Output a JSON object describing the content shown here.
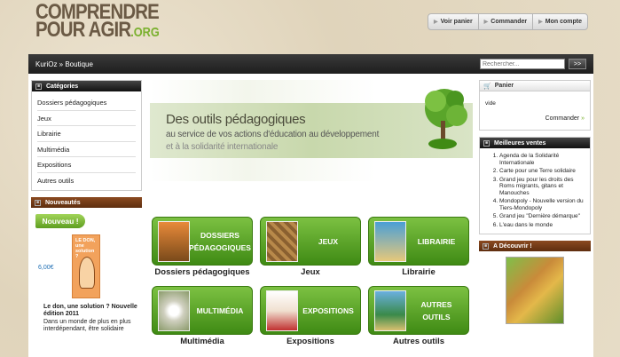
{
  "logo": {
    "line1": "COMPRENDRE",
    "line2": "POUR AGIR",
    "org": ".ORG"
  },
  "topnav": [
    {
      "label": "Voir panier"
    },
    {
      "label": "Commander"
    },
    {
      "label": "Mon compte"
    }
  ],
  "breadcrumb": "KuriOz » Boutique",
  "search": {
    "placeholder": "Rechercher...",
    "button": ">>"
  },
  "categories": {
    "title": "Catégories",
    "items": [
      "Dossiers pédagogiques",
      "Jeux",
      "Librairie",
      "Multimédia",
      "Expositions",
      "Autres outils"
    ]
  },
  "nouveautes": {
    "title": "Nouveautés",
    "ribbon": "Nouveau !",
    "price": "6,00€",
    "book_title": "LE DON, une solution ?",
    "item_title": "Le don, une solution ? Nouvelle édition 2011",
    "item_desc": "Dans un monde de plus en plus interdépendant, être solidaire"
  },
  "banner": {
    "line1": "Des outils pédagogiques",
    "line2": "au service de vos actions d'éducation au développement",
    "line3": "et à la solidarité internationale"
  },
  "tiles": [
    {
      "label1": "DOSSIERS",
      "label2": "PÉDAGOGIQUES",
      "caption": "Dossiers pédagogiques"
    },
    {
      "label1": "JEUX",
      "label2": "",
      "caption": "Jeux"
    },
    {
      "label1": "LIBRAIRIE",
      "label2": "",
      "caption": "Librairie"
    },
    {
      "label1": "MULTIMÉDIA",
      "label2": "",
      "caption": "Multimédia"
    },
    {
      "label1": "EXPOSITIONS",
      "label2": "",
      "caption": "Expositions"
    },
    {
      "label1": "AUTRES",
      "label2": "OUTILS",
      "caption": "Autres outils"
    }
  ],
  "panier": {
    "title": "Panier",
    "status": "vide",
    "commander": "Commander",
    "arrow": "»"
  },
  "best": {
    "title": "Meilleures ventes",
    "items": [
      "Agenda de la Solidarité Internationale",
      "Carte pour une Terre solidaire",
      "Grand jeu pour les droits des Roms migrants, gitans et Manouches",
      "Mondopoly - Nouvelle version du Tiers-Mondopoly",
      "Grand jeu \"Dernière démarque\"",
      "L'eau dans le monde"
    ]
  },
  "decouvrir": {
    "title": "A Découvrir !"
  },
  "colors": {
    "accent_green": "#7ab02e",
    "bar_dark": "#1e1e1e",
    "brown_header": "#6b3814"
  }
}
